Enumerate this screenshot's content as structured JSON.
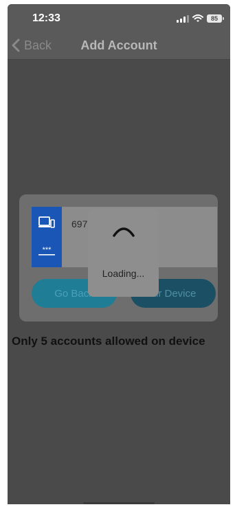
{
  "status_bar": {
    "time": "12:33",
    "battery": "85",
    "icons": [
      "signal-icon",
      "wifi-icon",
      "battery-icon"
    ]
  },
  "nav": {
    "back_label": "Back",
    "title": "Add Account",
    "back_icon": "chevron-left-icon"
  },
  "account": {
    "number": "697",
    "icons": [
      "device-icon",
      "password-icon"
    ],
    "icon_color": "#1a56b5"
  },
  "buttons": {
    "go_back": "Go Back",
    "pair_device": "air Device"
  },
  "loading": {
    "text": "Loading...",
    "icon": "spinner-icon"
  },
  "notice": "Only 5 accounts allowed on device",
  "colors": {
    "overlay": "#4a4a4a",
    "go_back_button": "#1f7d95",
    "pair_device_button": "#1b4f64"
  }
}
